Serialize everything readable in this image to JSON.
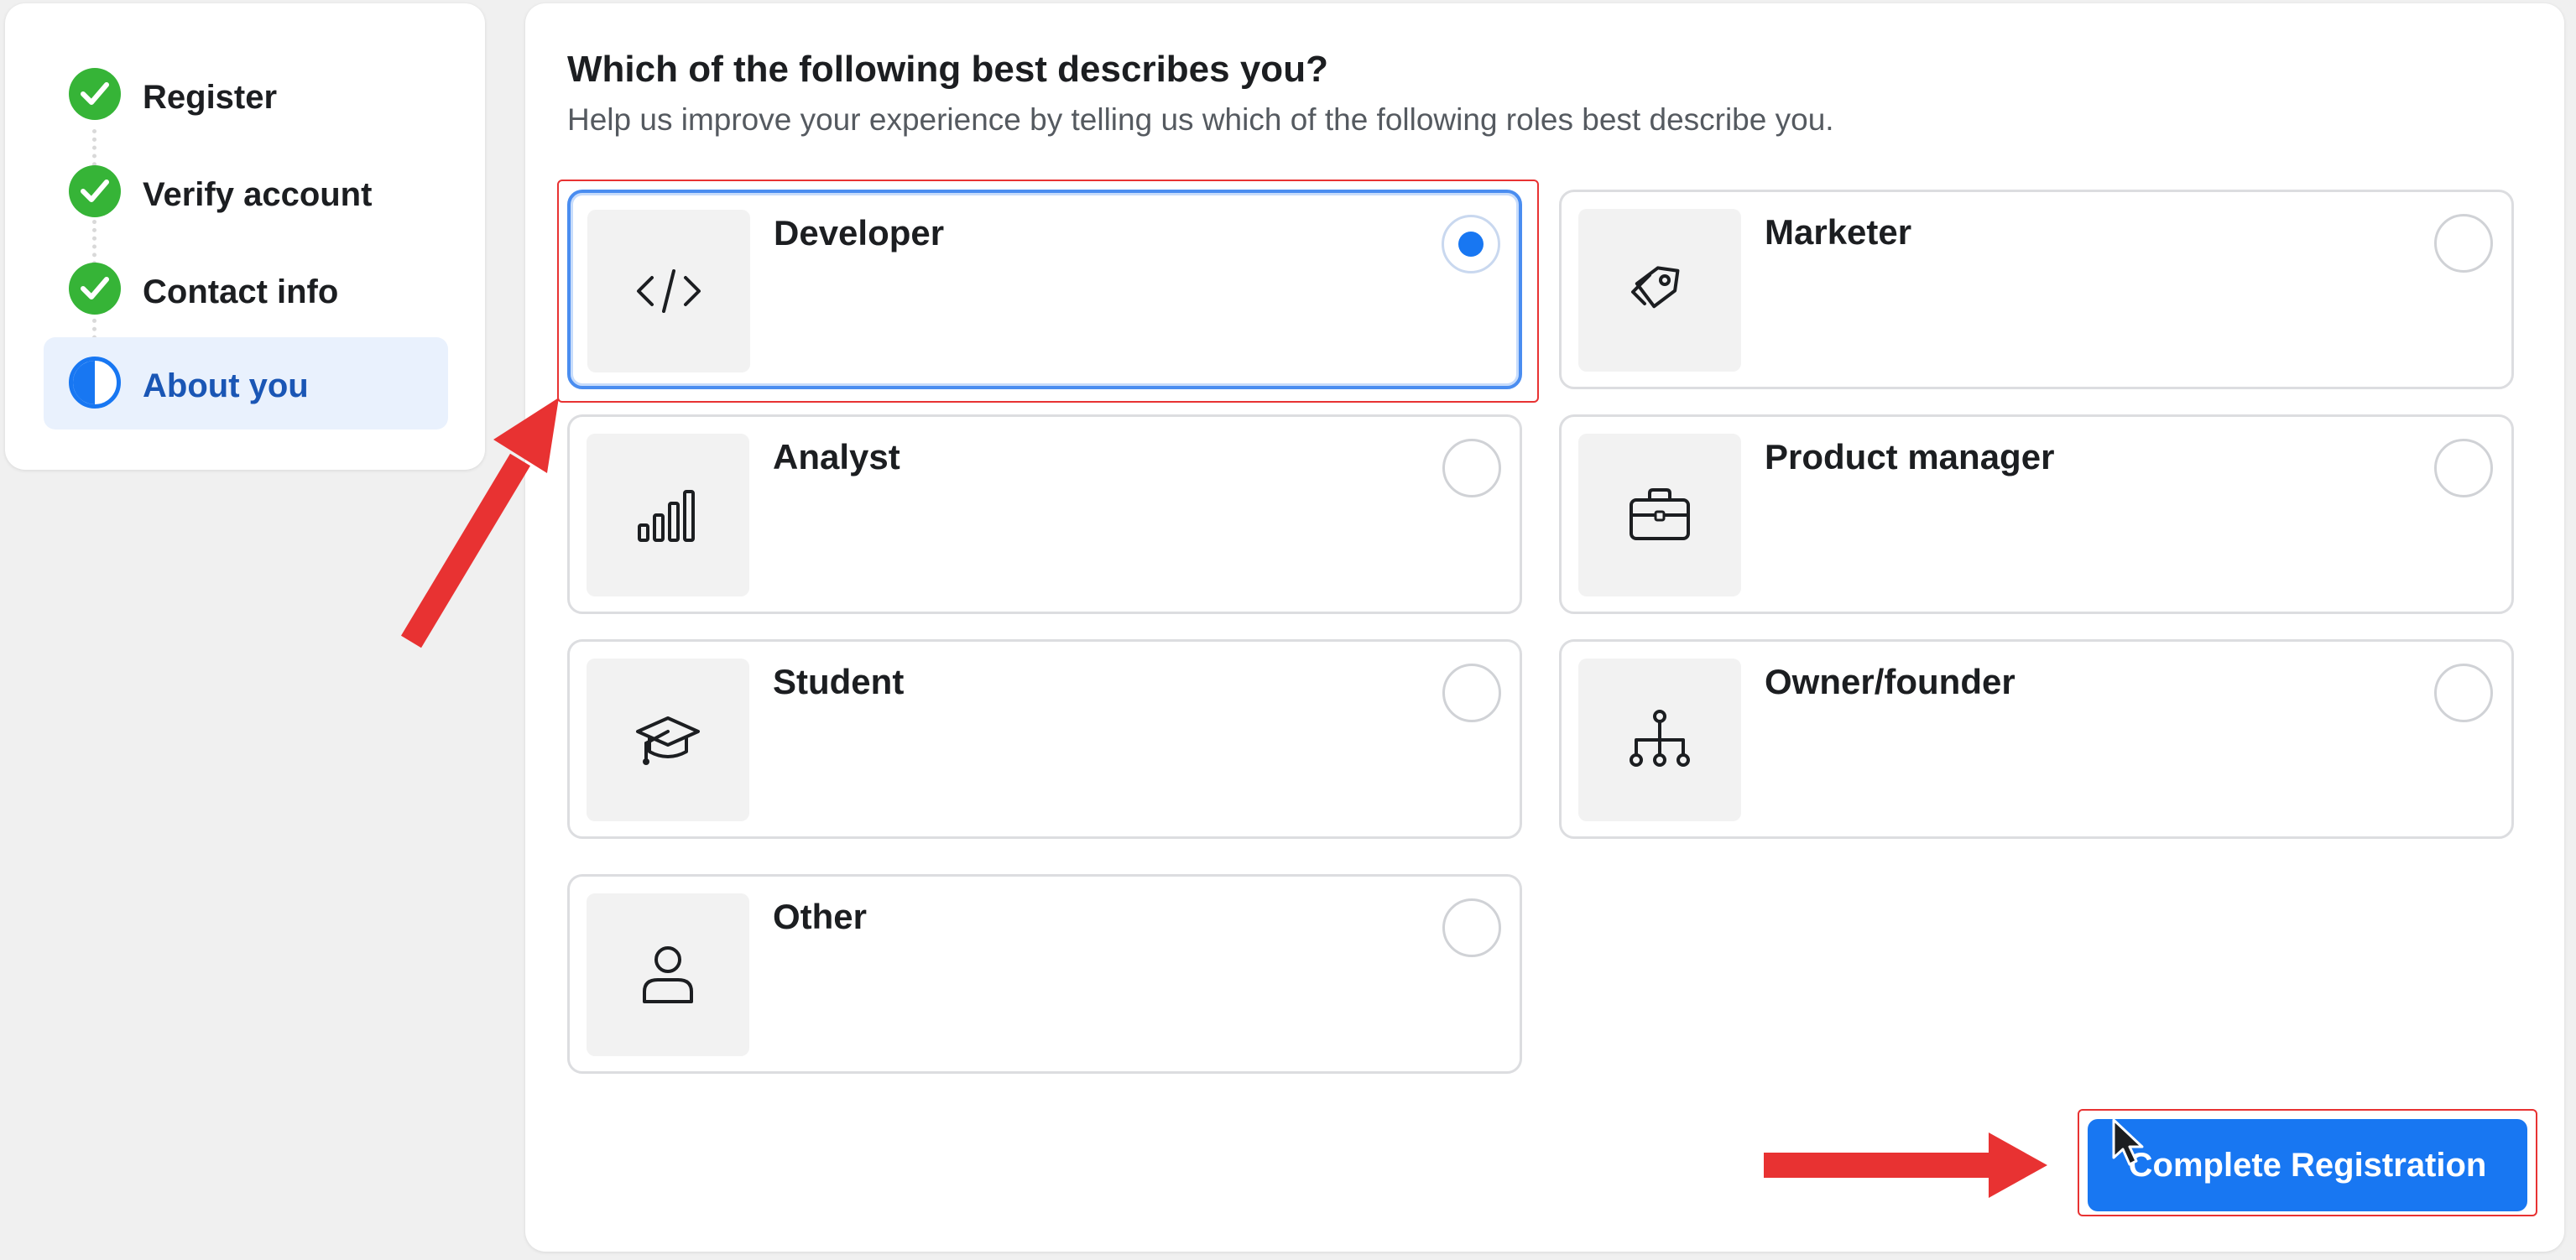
{
  "sidebar": {
    "steps": [
      {
        "label": "Register",
        "state": "done"
      },
      {
        "label": "Verify account",
        "state": "done"
      },
      {
        "label": "Contact info",
        "state": "done"
      },
      {
        "label": "About you",
        "state": "active"
      }
    ]
  },
  "form": {
    "heading": "Which of the following best describes you?",
    "subheading": "Help us improve your experience by telling us which of the following roles best describe you.",
    "selected_role": "Developer",
    "roles": [
      {
        "label": "Developer",
        "icon": "code-icon"
      },
      {
        "label": "Marketer",
        "icon": "tags-icon"
      },
      {
        "label": "Analyst",
        "icon": "bar-chart-icon"
      },
      {
        "label": "Product manager",
        "icon": "briefcase-icon"
      },
      {
        "label": "Student",
        "icon": "graduation-cap-icon"
      },
      {
        "label": "Owner/founder",
        "icon": "org-chart-icon"
      },
      {
        "label": "Other",
        "icon": "person-icon"
      }
    ],
    "submit_label": "Complete Registration"
  },
  "colors": {
    "accent": "#1877f2",
    "success": "#36b437",
    "annotation": "#e83232"
  }
}
